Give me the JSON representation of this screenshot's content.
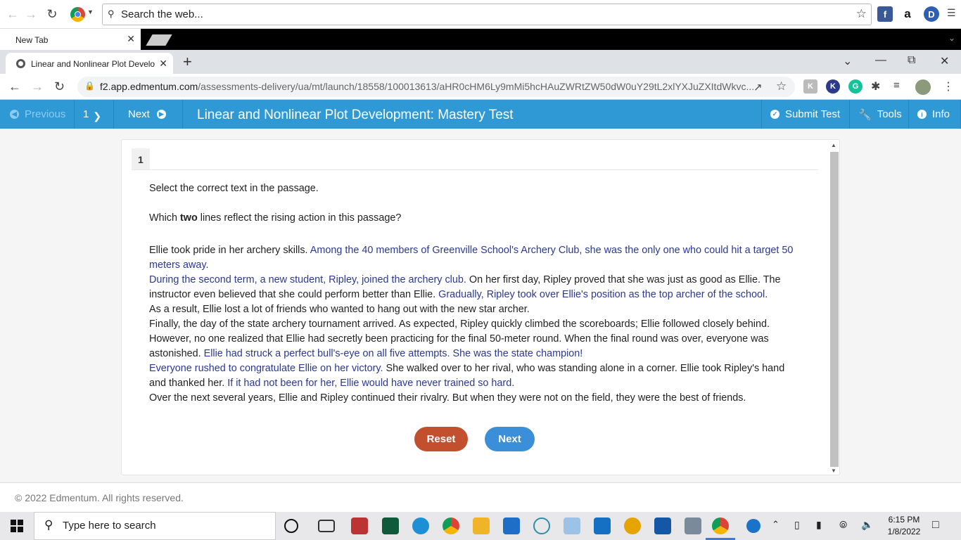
{
  "browser_top": {
    "search_placeholder": "Search the web..."
  },
  "background_tab": {
    "label": "New Tab"
  },
  "active_tab": {
    "label": "Linear and Nonlinear Plot Develo"
  },
  "address": {
    "host": "f2.app.edmentum.com",
    "path": "/assessments-delivery/ua/mt/launch/18558/100013613/aHR0cHM6Ly9mMi5hcHAuZWRtZW50dW0uY29tL2xlYXJuZXItdWkvc..."
  },
  "app_header": {
    "previous": "Previous",
    "question_number": "1",
    "next": "Next",
    "title": "Linear and Nonlinear Plot Development: Mastery Test",
    "submit": "Submit Test",
    "tools": "Tools",
    "info": "Info"
  },
  "question": {
    "number": "1",
    "instruction": "Select the correct text in the passage.",
    "prompt_before": "Which ",
    "prompt_bold": "two",
    "prompt_after": " lines reflect the rising action in this passage?"
  },
  "passage": [
    {
      "text": "Ellie took pride in her archery skills. ",
      "selectable": false
    },
    {
      "text": " Among the 40 members of Greenville School's Archery Club, she was the only one who could hit a target 50 meters away.",
      "selectable": true
    },
    {
      "text": "\n",
      "selectable": false
    },
    {
      "text": " During the second term, a new student, Ripley, joined the archery club.",
      "selectable": true
    },
    {
      "text": "  On her first day, Ripley proved that she was just as good as Ellie. The instructor even believed that she could perform better than Ellie. ",
      "selectable": false
    },
    {
      "text": " Gradually, Ripley took over Ellie's position as the top archer of the school.",
      "selectable": true
    },
    {
      "text": "\nAs a result, Ellie lost a lot of friends who wanted to hang out with the new star archer.\nFinally, the day of the state archery tournament arrived. As expected, Ripley quickly climbed the scoreboards; Ellie followed closely behind. However, no one realized that Ellie had secretly been practicing for the final 50-meter round. When the final round was over, everyone was astonished. ",
      "selectable": false
    },
    {
      "text": " Ellie had struck a perfect bull's-eye on all five attempts. She was the state champion!",
      "selectable": true
    },
    {
      "text": "\n",
      "selectable": false
    },
    {
      "text": " Everyone rushed to congratulate Ellie on her victory.",
      "selectable": true
    },
    {
      "text": "  She walked over to her rival, who was standing alone in a corner. Ellie took Ripley's hand and thanked her. ",
      "selectable": false
    },
    {
      "text": " If it had not been for her, Ellie would have never trained so hard.",
      "selectable": true
    },
    {
      "text": "\nOver the next several years, Ellie and Ripley continued their rivalry. But when they were not on the field, they were the best of friends.",
      "selectable": false
    }
  ],
  "buttons": {
    "reset": "Reset",
    "next": "Next"
  },
  "footer": {
    "copyright": "© 2022 Edmentum. All rights reserved."
  },
  "taskbar": {
    "search_placeholder": "Type here to search",
    "time": "6:15 PM",
    "date": "1/8/2022"
  },
  "colors": {
    "header_blue": "#2f99d5",
    "selectable_text": "#2b3990",
    "reset_red": "#c2502f",
    "next_blue": "#3b8fd8"
  }
}
